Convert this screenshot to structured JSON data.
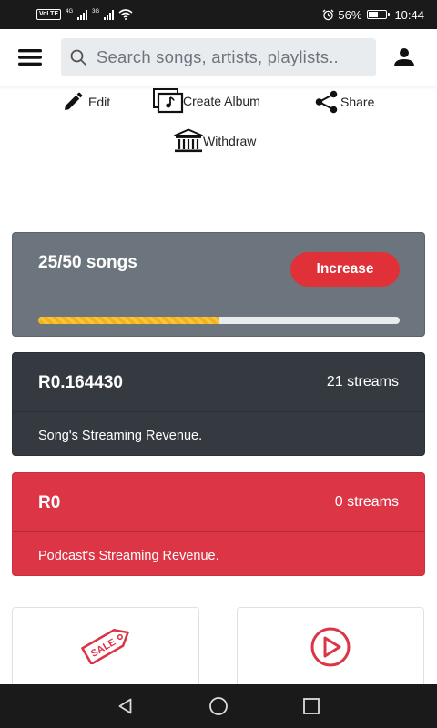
{
  "status_bar": {
    "volte": "VoLTE",
    "net1": "4G",
    "net2": "3G",
    "battery_percent": "56%",
    "battery_level": 0.56,
    "time": "10:44"
  },
  "header": {
    "search_placeholder": "Search songs, artists, playlists.."
  },
  "actions": {
    "edit": "Edit",
    "create_album": "Create Album",
    "share": "Share",
    "withdraw": "Withdraw"
  },
  "song_limit": {
    "label": "25/50 songs",
    "used": 25,
    "total": 50,
    "increase_label": "Increase"
  },
  "song_revenue": {
    "amount": "R0.164430",
    "streams": "21 streams",
    "caption": "Song's Streaming Revenue."
  },
  "podcast_revenue": {
    "amount": "R0",
    "streams": "0 streams",
    "caption": "Podcast's Streaming Revenue."
  },
  "tiles": {
    "sale_icon_text": "SALE"
  },
  "colors": {
    "danger": "#dc3545",
    "dark": "#343a40",
    "secondary": "#6c757d",
    "warning": "#f5b311"
  }
}
